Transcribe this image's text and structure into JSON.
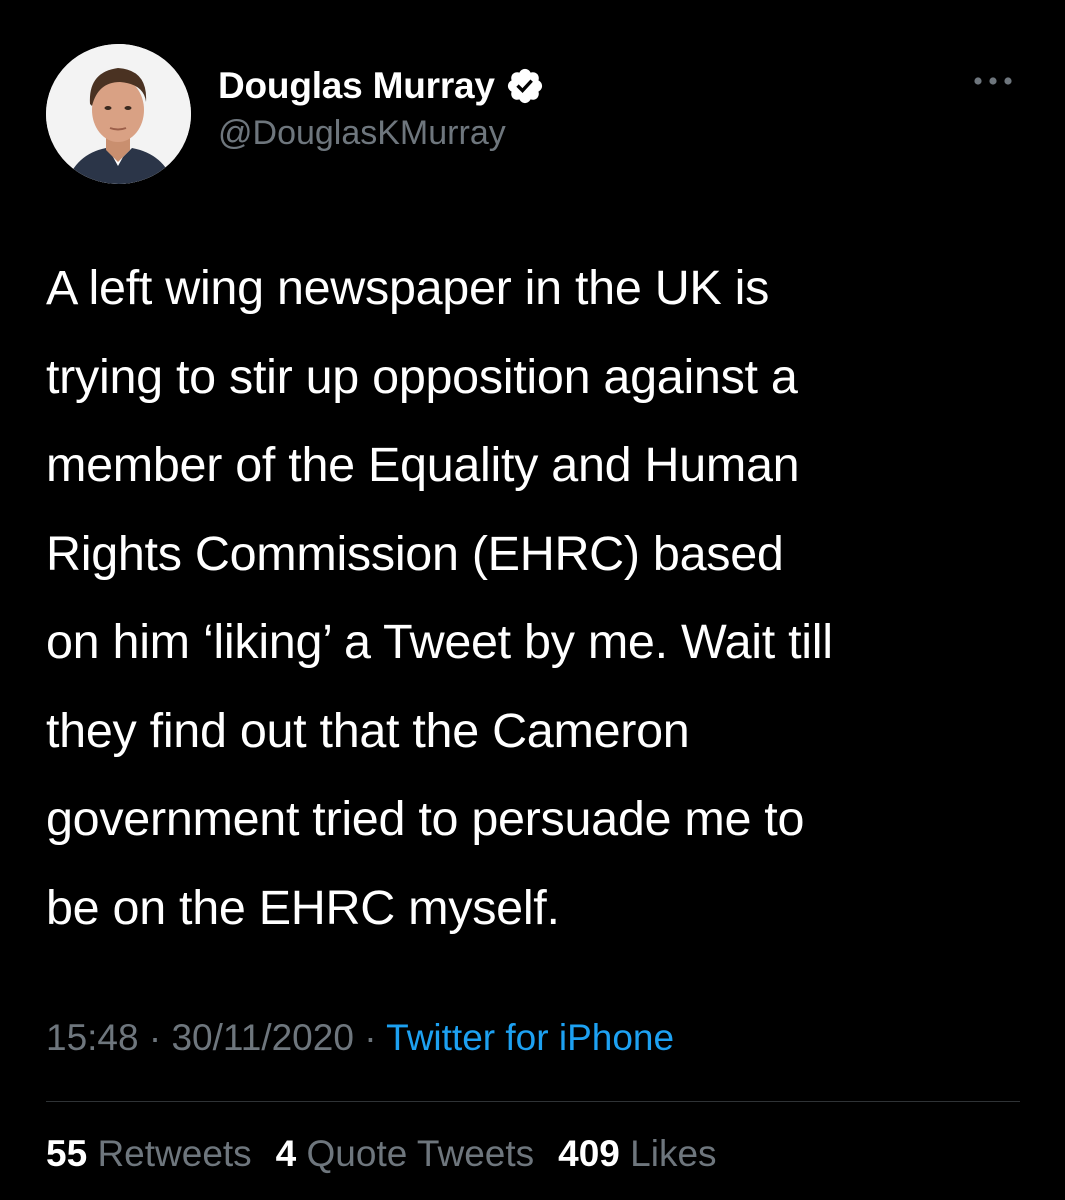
{
  "author": {
    "display_name": "Douglas Murray",
    "handle": "@DouglasKMurray",
    "verified_icon": "verified-badge-icon",
    "avatar_icon": "profile-photo"
  },
  "tweet": {
    "text_lines": [
      "A left wing newspaper in the UK is",
      "trying to stir up opposition against a",
      "member of the Equality and Human",
      "Rights Commission (EHRC) based",
      "on him ‘liking’ a Tweet by me. Wait till",
      "they find out that the Cameron",
      "government tried to persuade me to",
      "be on the EHRC myself."
    ]
  },
  "meta": {
    "time": "15:48",
    "separator": "·",
    "date": "30/11/2020",
    "source": "Twitter for iPhone"
  },
  "stats": {
    "retweets_count": "55",
    "retweets_label": "Retweets",
    "quotes_count": "4",
    "quotes_label": "Quote Tweets",
    "likes_count": "409",
    "likes_label": "Likes"
  },
  "colors": {
    "background": "#000000",
    "text": "#ffffff",
    "secondary": "#6e767d",
    "link": "#1da1f2",
    "divider": "#2f3336"
  }
}
